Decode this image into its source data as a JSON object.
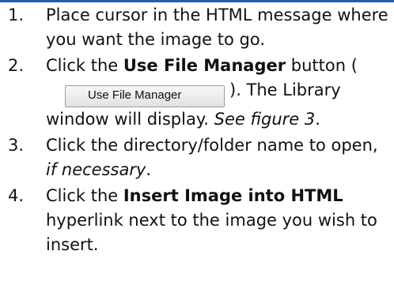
{
  "steps": [
    {
      "number": "1.",
      "text": "Place cursor in the HTML message where you want the image to go."
    },
    {
      "number": "2.",
      "before": "Click the ",
      "bold": "Use File Manager",
      "after_bold": " button (",
      "button_label": "Use File Manager",
      "after_button": ").  The Library window will display.  ",
      "italic": "See figure 3",
      "end": "."
    },
    {
      "number": "3.",
      "text": "Click the directory/folder name to open, ",
      "italic": "if necessary",
      "end": "."
    },
    {
      "number": "4.",
      "before": "Click the ",
      "bold": "Insert Image into HTML",
      "after_bold": " hyperlink next to the image you wish to insert."
    }
  ]
}
